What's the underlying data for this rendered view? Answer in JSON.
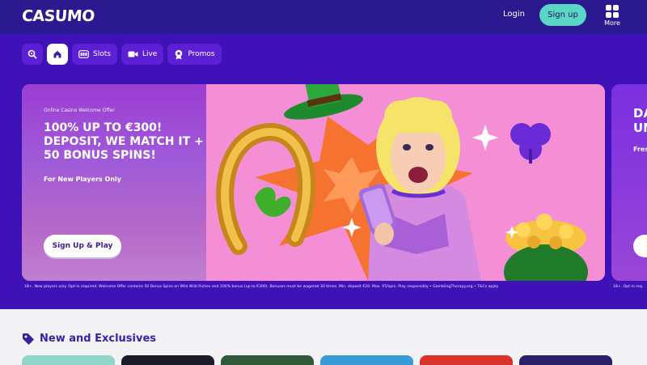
{
  "header": {
    "logo": "CASUMO",
    "login_label": "Login",
    "signup_label": "Sign up",
    "more_label": "More"
  },
  "nav": {
    "items": [
      {
        "label": "",
        "icon": "search-icon"
      },
      {
        "label": "",
        "icon": "home-icon",
        "active": true
      },
      {
        "label": "Slots",
        "icon": "slots-icon"
      },
      {
        "label": "Live",
        "icon": "camera-icon"
      },
      {
        "label": "Promos",
        "icon": "rosette-icon"
      }
    ]
  },
  "banner": {
    "eyebrow": "Online Casino Welcome Offer",
    "headline": "100% UP TO €300! DEPOSIT, WE MATCH IT + 50 BONUS SPINS!",
    "sub": "For New Players Only",
    "cta_label": "Sign Up & Play",
    "terms": "18+. New players only. Opt-in required. Welcome Offer contains 50 Bonus Spins on Wild Wild Riches and 100% bonus (up to €300). Bonuses must be wagered 30 times. Min. deposit €20. Max. €5/spin. Play responsibly • GamblingTherapy.org • T&Cs apply"
  },
  "banner_next": {
    "headline_partial": "DA UN",
    "sub_partial": "Fres",
    "terms_partial": "18+. Opt-in req."
  },
  "section": {
    "title": "New and Exclusives"
  },
  "colors": {
    "header_bg": "#2b1a8f",
    "hero_bg": "#3f12b8",
    "signup_bg": "#5ad6c6",
    "nav_pill": "#5d1fd4",
    "section_title": "#3b1fa6"
  }
}
